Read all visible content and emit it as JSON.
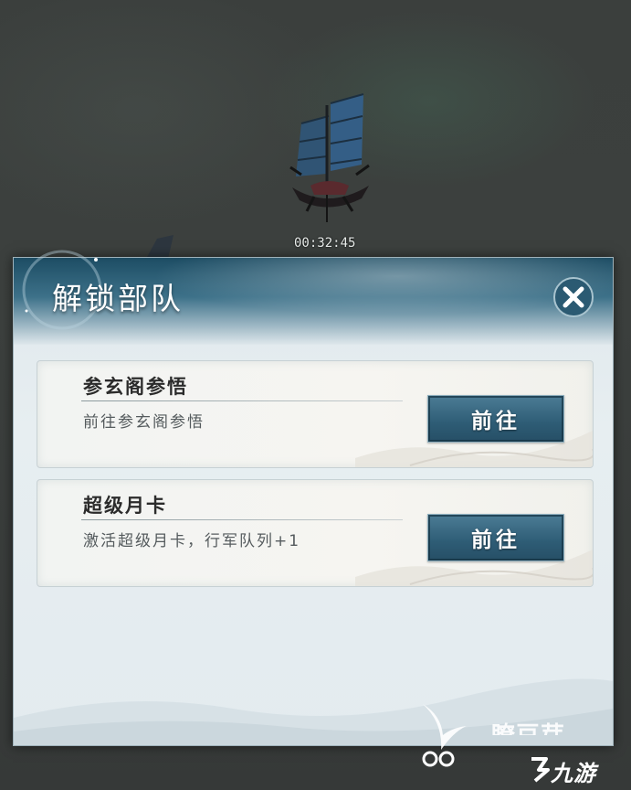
{
  "hud": {
    "timer": "00:32:45"
  },
  "dialog": {
    "title": "解锁部队",
    "close_icon": "close-x-icon",
    "entries": [
      {
        "title": "参玄阁参悟",
        "description": "前往参玄阁参悟",
        "button_label": "前往"
      },
      {
        "title": "超级月卡",
        "description": "激活超级月卡，行军队列+1",
        "button_label": "前往"
      }
    ]
  },
  "watermark": {
    "text_partial": "瞭豆芽",
    "logo_text": "九游"
  },
  "colors": {
    "header_dark": "#1d4d64",
    "button_bg": "#2e5c75",
    "dialog_bg": "#e3ebef"
  }
}
